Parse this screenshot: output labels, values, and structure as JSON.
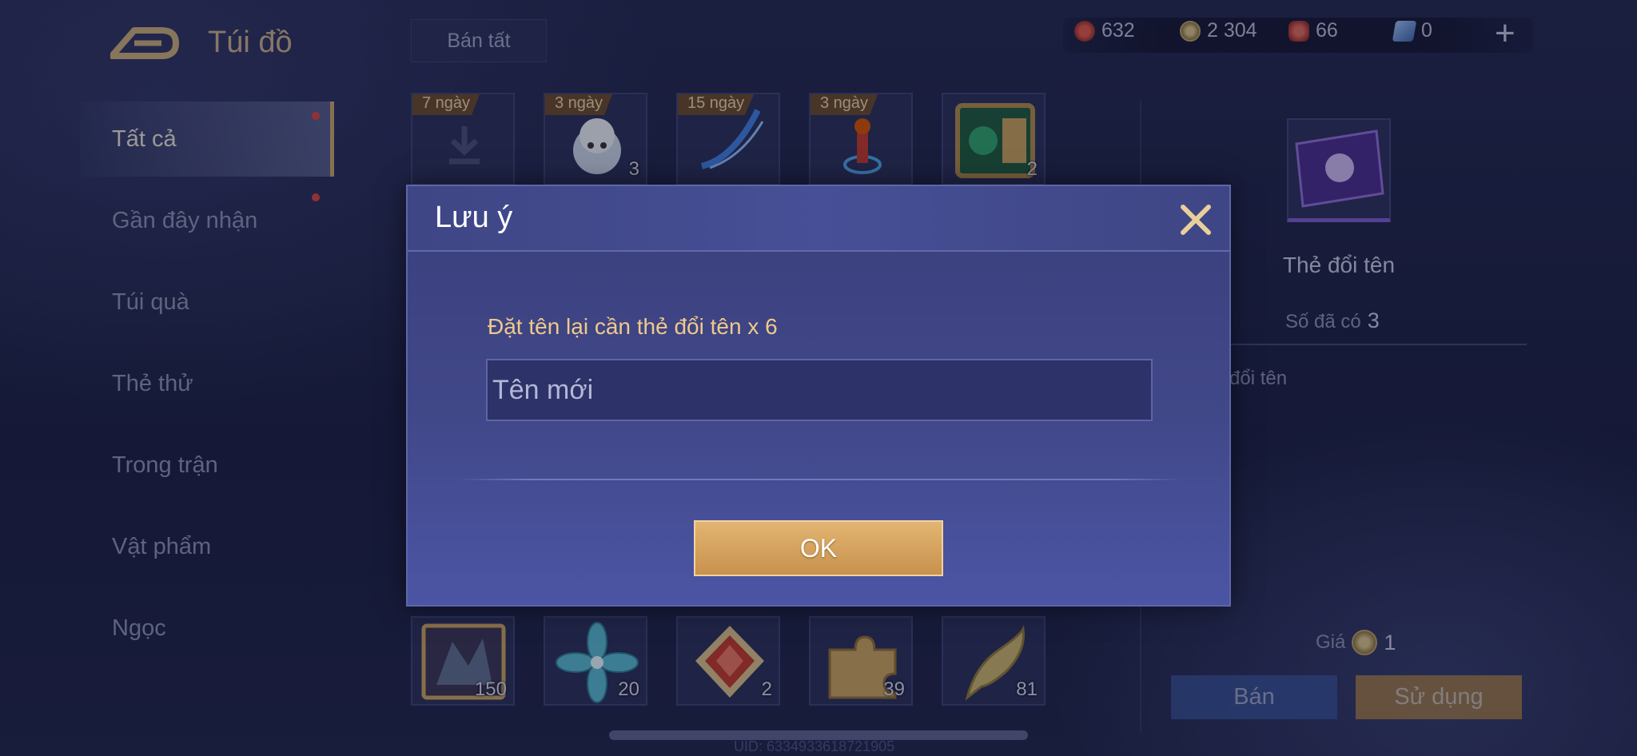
{
  "header": {
    "title": "Túi đồ",
    "sell_all_label": "Bán tất",
    "currencies": [
      {
        "icon": "red-voucher-icon",
        "value": "632",
        "color": "#c0392b"
      },
      {
        "icon": "gold-coin-icon",
        "value": "2 304",
        "color": "#c9a96a"
      },
      {
        "icon": "ruby-icon",
        "value": "66",
        "color": "#c0433b"
      },
      {
        "icon": "card-icon",
        "value": "0",
        "color": "#6a8fd0"
      }
    ],
    "plus_symbol": "+"
  },
  "sidebar": {
    "items": [
      {
        "label": "Tất cả"
      },
      {
        "label": "Gần đây nhận"
      },
      {
        "label": "Túi quà"
      },
      {
        "label": "Thẻ thử"
      },
      {
        "label": "Trong trận"
      },
      {
        "label": "Vật phẩm"
      },
      {
        "label": "Ngọc"
      }
    ]
  },
  "grid": {
    "top_row": [
      {
        "days": "7 ngày",
        "count": "",
        "icon": "download-icon"
      },
      {
        "days": "3 ngày",
        "count": "3",
        "icon": "hero-avatar-icon"
      },
      {
        "days": "15 ngày",
        "count": "",
        "icon": "blue-trail-icon"
      },
      {
        "days": "3 ngày",
        "count": "",
        "icon": "potion-icon"
      },
      {
        "days": "",
        "count": "2",
        "icon": "chest-icon"
      }
    ],
    "bottom_row": [
      {
        "count": "150",
        "icon": "skin-card-icon"
      },
      {
        "count": "20",
        "icon": "blue-flower-icon"
      },
      {
        "count": "2",
        "icon": "red-gem-icon"
      },
      {
        "count": "39",
        "icon": "puzzle-piece-icon"
      },
      {
        "count": "81",
        "icon": "gold-fish-icon"
      }
    ]
  },
  "detail": {
    "name": "Thẻ đổi tên",
    "owned_label": "Số đã có",
    "owned_value": "3",
    "description_fragment": "đổi tên",
    "price_label": "Giá",
    "price_value": "1",
    "sell_label": "Bán",
    "use_label": "Sử dụng"
  },
  "footer": {
    "uid": "UID: 6334933618721905"
  },
  "modal": {
    "title": "Lưu ý",
    "message": "Đặt tên lại cần thẻ đổi tên x 6",
    "input_placeholder": "Tên mới",
    "input_value": "",
    "ok_label": "OK"
  }
}
